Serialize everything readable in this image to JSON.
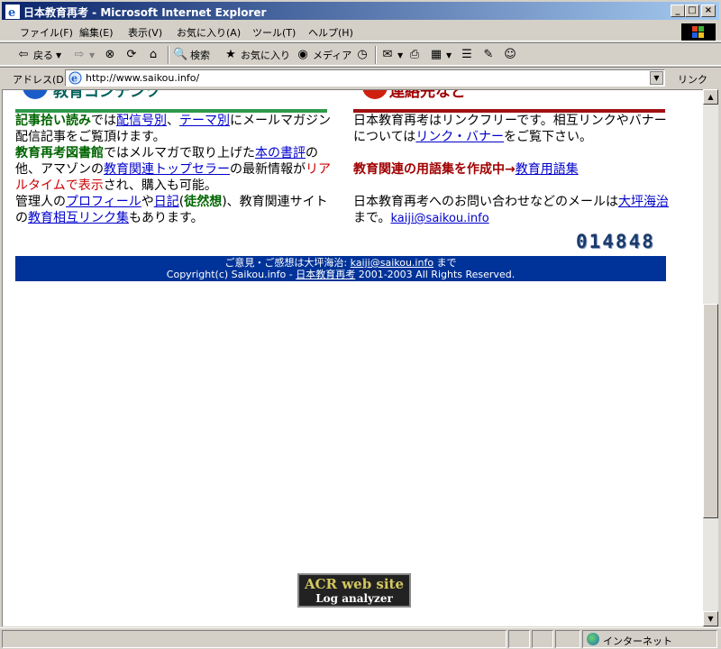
{
  "window": {
    "title": "日本教育再考 - Microsoft Internet Explorer",
    "minimize": "_",
    "maximize": "□",
    "close": "×"
  },
  "menu": [
    "ファイル(F)",
    "編集(E)",
    "表示(V)",
    "お気に入り(A)",
    "ツール(T)",
    "ヘルプ(H)"
  ],
  "toolbar": {
    "back": "戻る",
    "search": "検索",
    "favorites": "お気に入り",
    "media": "メディア"
  },
  "address": {
    "label": "アドレス(D)",
    "url": "http://www.saikou.info/",
    "links": "リンク"
  },
  "content": {
    "left_heading": "教育コンテンツ",
    "left_heading_color": "#2e9a4a",
    "right_heading": "連絡先など",
    "right_heading_color": "#a01010",
    "left": {
      "p1_kw": "記事拾い読み",
      "p1_t1": "では",
      "p1_link1": "配信号別",
      "p1_t2": "、",
      "p1_link2": "テーマ別",
      "p1_t3": "にメールマガジン配信記事をご覧頂けます。",
      "p2_kw": "教育再考図書館",
      "p2_t1": "ではメルマガで取り上げた",
      "p2_link1": "本の書評",
      "p2_t2": "の他、アマゾンの",
      "p2_link2": "教育関連トップセラー",
      "p2_t3": "の最新情報が",
      "p2_red": "リアルタイムで表示",
      "p2_t4": "され、購入も可能。",
      "p3_t1": "管理人の",
      "p3_link1": "プロフィール",
      "p3_t2": "や",
      "p3_link2": "日記",
      "p3_t3": "(",
      "p3_kw": "徒然想",
      "p3_t4": ")、教育関連サイトの",
      "p3_link3": "教育相互リンク集",
      "p3_t5": "もあります。"
    },
    "right": {
      "p1_t1": "日本教育再考はリンクフリーです。相互リンクやバナーについては",
      "p1_link": "リンク・バナー",
      "p1_t2": "をご覧下さい。",
      "p2_kw": "教育関連の用語集を作成中",
      "p2_arrow": "→",
      "p2_link": "教育用語集",
      "p3_t1": "日本教育再考へのお問い合わせなどのメールは",
      "p3_link1": "大坪海治",
      "p3_t2": "まで。",
      "p3_link2": "kaiji@saikou.info"
    },
    "counter": "014848",
    "footer": {
      "line1_t1": "ご意見・ご感想は大坪海治: ",
      "line1_link": "kaiji@saikou.info",
      "line1_t2": " まで",
      "line2_t1": "Copyright(c) Saikou.info - ",
      "line2_link": "日本教育再考",
      "line2_t2": " 2001-2003 All Rights Reserved."
    },
    "badge": {
      "line1": "ACR web site",
      "line2": "Log analyzer"
    }
  },
  "status": {
    "zone": "インターネット"
  }
}
